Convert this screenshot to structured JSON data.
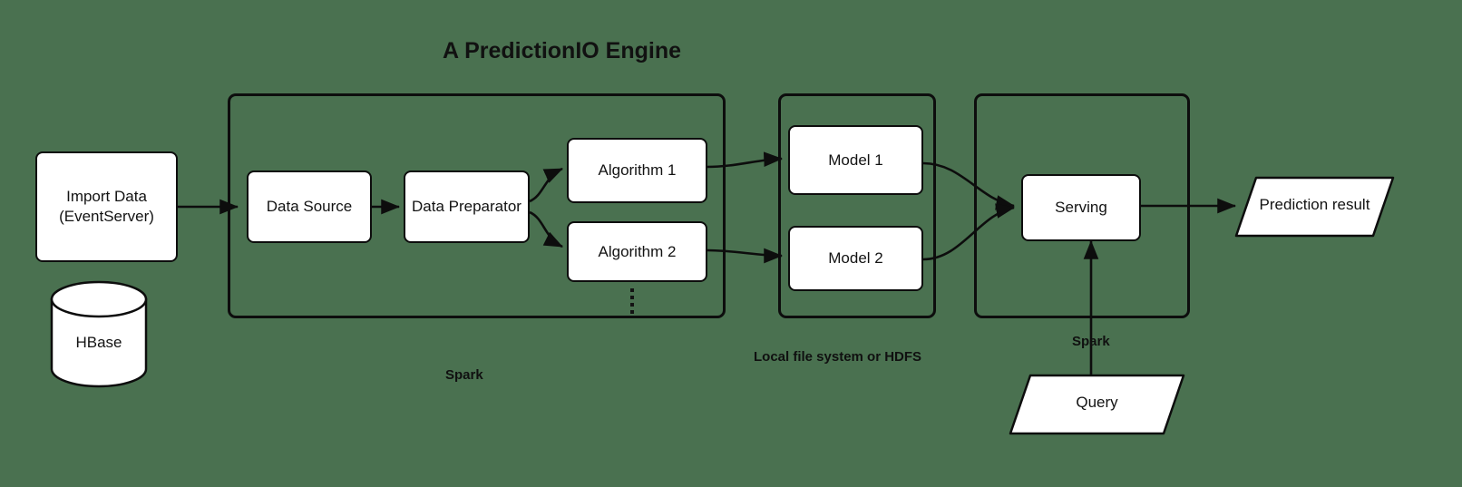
{
  "diagram": {
    "title": "A PredictionIO Engine",
    "background_color": "#4a7150",
    "stroke_color": "#0d0d0d",
    "node_fill": "#ffffff"
  },
  "nodes": {
    "import_data": "Import Data\n(EventServer)",
    "import_data_line1": "Import Data",
    "import_data_line2": "(EventServer)",
    "hbase": "HBase",
    "data_source": "Data Source",
    "data_preparator": "Data Preparator",
    "algorithm_1": "Algorithm 1",
    "algorithm_2": "Algorithm 2",
    "algorithm_more": "⋮",
    "model_1": "Model 1",
    "model_2": "Model 2",
    "serving": "Serving",
    "query": "Query",
    "prediction_result": "Prediction result"
  },
  "captions": {
    "engine_spark": "Spark",
    "storage": "Local file system or HDFS",
    "serving_spark": "Spark"
  }
}
